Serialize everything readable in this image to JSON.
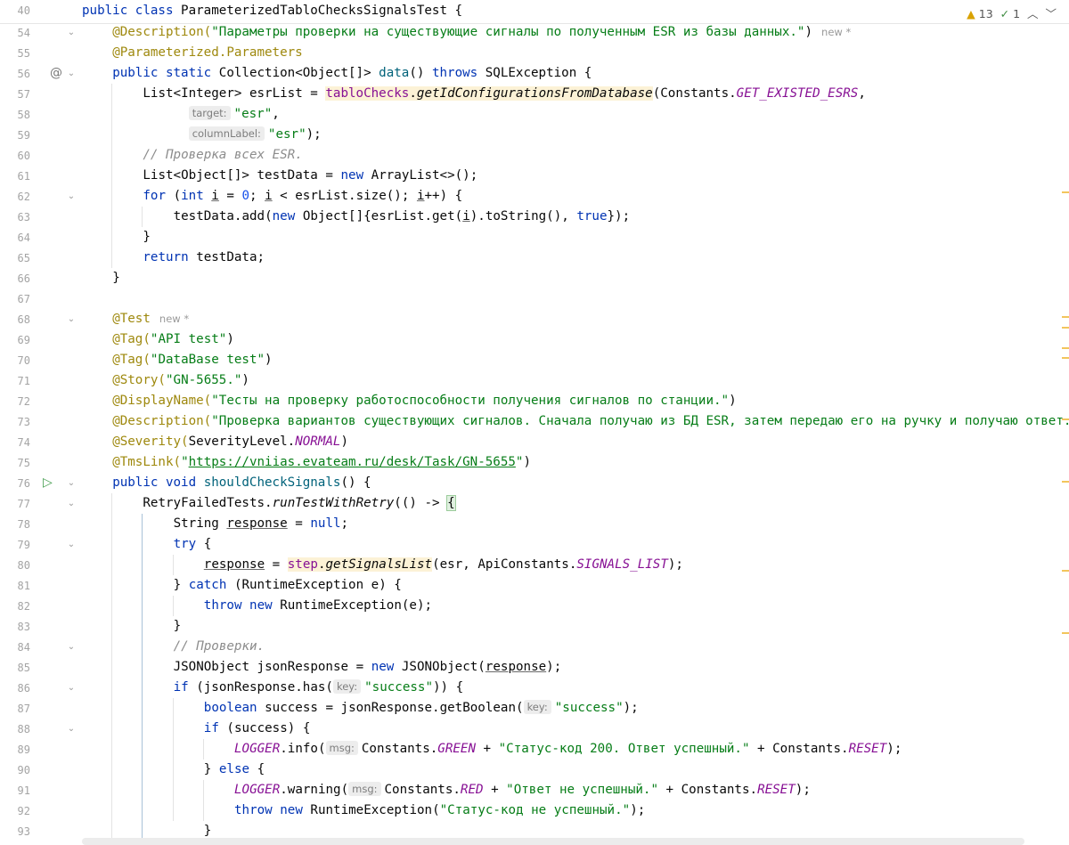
{
  "sticky": {
    "line_no": "40",
    "parts": [
      {
        "t": "public class ",
        "c": "kw"
      },
      {
        "t": "ParameterizedTabloChecksSignalsTest {",
        "c": ""
      }
    ]
  },
  "inspection": {
    "warnings": "13",
    "weak": "1"
  },
  "icons": {
    "warning": "warning-icon",
    "check": "check-icon",
    "up": "chevron-up-icon",
    "down": "chevron-down-icon",
    "run": "run-icon",
    "override": "implementation-icon",
    "fold": "fold-icon"
  },
  "lines": [
    {
      "n": "54",
      "fold": true,
      "parts": [
        {
          "t": "@Description(",
          "c": "an"
        },
        {
          "t": "\"Параметры проверки на существующие сигналы по полученным ESR из базы данных.\"",
          "c": "str"
        },
        {
          "t": ")",
          "c": ""
        },
        {
          "t": "new *",
          "c": "new"
        }
      ]
    },
    {
      "n": "55",
      "parts": [
        {
          "t": "@Parameterized.",
          "c": "an"
        },
        {
          "t": "Parameters",
          "c": "an"
        }
      ]
    },
    {
      "n": "56",
      "fold": true,
      "icon": "override",
      "parts": [
        {
          "t": "public static ",
          "c": "kw"
        },
        {
          "t": "Collection<Object[]> ",
          "c": ""
        },
        {
          "t": "data",
          "c": "fn"
        },
        {
          "t": "() ",
          "c": ""
        },
        {
          "t": "throws ",
          "c": "kw"
        },
        {
          "t": "SQLException {",
          "c": ""
        }
      ]
    },
    {
      "n": "57",
      "parts": [
        {
          "t": "List<Integer> esrList = ",
          "c": ""
        },
        {
          "t": "tabloChecks",
          "c": "fld hl"
        },
        {
          "t": ".",
          "c": "hl"
        },
        {
          "t": "getIdConfigurationsFromDatabase",
          "c": "it hl"
        },
        {
          "t": "(Constants.",
          "c": ""
        },
        {
          "t": "GET_EXISTED_ESRS",
          "c": "cst"
        },
        {
          "t": ",",
          "c": ""
        }
      ]
    },
    {
      "n": "58",
      "parts": [
        {
          "t": "target:",
          "c": "hint"
        },
        {
          "t": "\"esr\"",
          "c": "str"
        },
        {
          "t": ",",
          "c": ""
        }
      ]
    },
    {
      "n": "59",
      "parts": [
        {
          "t": "columnLabel:",
          "c": "hint"
        },
        {
          "t": "\"esr\"",
          "c": "str"
        },
        {
          "t": ");",
          "c": ""
        }
      ]
    },
    {
      "n": "60",
      "parts": [
        {
          "t": "// Проверка всех ESR.",
          "c": "cm"
        }
      ]
    },
    {
      "n": "61",
      "parts": [
        {
          "t": "List<Object[]> testData = ",
          "c": ""
        },
        {
          "t": "new ",
          "c": "kw"
        },
        {
          "t": "ArrayList<>();",
          "c": ""
        }
      ]
    },
    {
      "n": "62",
      "fold": true,
      "parts": [
        {
          "t": "for ",
          "c": "kw"
        },
        {
          "t": "(",
          "c": ""
        },
        {
          "t": "int ",
          "c": "kw"
        },
        {
          "t": "i",
          "c": "ul"
        },
        {
          "t": " = ",
          "c": ""
        },
        {
          "t": "0",
          "c": "num"
        },
        {
          "t": "; ",
          "c": ""
        },
        {
          "t": "i",
          "c": "ul"
        },
        {
          "t": " < esrList.size(); ",
          "c": ""
        },
        {
          "t": "i",
          "c": "ul"
        },
        {
          "t": "++) {",
          "c": ""
        }
      ]
    },
    {
      "n": "63",
      "parts": [
        {
          "t": "testData.add(",
          "c": ""
        },
        {
          "t": "new ",
          "c": "kw"
        },
        {
          "t": "Object[]{esrList.get(",
          "c": ""
        },
        {
          "t": "i",
          "c": "ul"
        },
        {
          "t": ").toString(), ",
          "c": ""
        },
        {
          "t": "true",
          "c": "kw"
        },
        {
          "t": "});",
          "c": ""
        }
      ]
    },
    {
      "n": "64",
      "parts": [
        {
          "t": "}",
          "c": ""
        }
      ]
    },
    {
      "n": "65",
      "parts": [
        {
          "t": "return ",
          "c": "kw"
        },
        {
          "t": "testData;",
          "c": ""
        }
      ]
    },
    {
      "n": "66",
      "parts": [
        {
          "t": "}",
          "c": ""
        }
      ]
    },
    {
      "n": "67",
      "parts": []
    },
    {
      "n": "68",
      "fold": true,
      "parts": [
        {
          "t": "@Test",
          "c": "an"
        },
        {
          "t": "new *",
          "c": "new"
        }
      ]
    },
    {
      "n": "69",
      "parts": [
        {
          "t": "@Tag(",
          "c": "an"
        },
        {
          "t": "\"API test\"",
          "c": "str"
        },
        {
          "t": ")",
          "c": ""
        }
      ]
    },
    {
      "n": "70",
      "parts": [
        {
          "t": "@Tag(",
          "c": "an"
        },
        {
          "t": "\"DataBase test\"",
          "c": "str"
        },
        {
          "t": ")",
          "c": ""
        }
      ]
    },
    {
      "n": "71",
      "parts": [
        {
          "t": "@Story(",
          "c": "an"
        },
        {
          "t": "\"GN-5655.\"",
          "c": "str"
        },
        {
          "t": ")",
          "c": ""
        }
      ]
    },
    {
      "n": "72",
      "parts": [
        {
          "t": "@DisplayName(",
          "c": "an"
        },
        {
          "t": "\"Тесты на проверку работоспособности получения сигналов по станции.\"",
          "c": "str"
        },
        {
          "t": ")",
          "c": ""
        }
      ]
    },
    {
      "n": "73",
      "parts": [
        {
          "t": "@Description(",
          "c": "an"
        },
        {
          "t": "\"Проверка вариантов существующих сигналов. Сначала получаю из БД ESR, затем передаю его на ручку и получаю ответ.\"",
          "c": "str"
        },
        {
          "t": ")",
          "c": ""
        }
      ]
    },
    {
      "n": "74",
      "parts": [
        {
          "t": "@Severity(",
          "c": "an"
        },
        {
          "t": "SeverityLevel.",
          "c": ""
        },
        {
          "t": "NORMAL",
          "c": "cst"
        },
        {
          "t": ")",
          "c": ""
        }
      ]
    },
    {
      "n": "75",
      "parts": [
        {
          "t": "@TmsLink(",
          "c": "an"
        },
        {
          "t": "\"",
          "c": "str"
        },
        {
          "t": "https://vniias.evateam.ru/desk/Task/GN-5655",
          "c": "link"
        },
        {
          "t": "\"",
          "c": "str"
        },
        {
          "t": ")",
          "c": ""
        }
      ]
    },
    {
      "n": "76",
      "fold": true,
      "icon": "run",
      "parts": [
        {
          "t": "public void ",
          "c": "kw"
        },
        {
          "t": "shouldCheckSignals",
          "c": "fn"
        },
        {
          "t": "() {",
          "c": ""
        }
      ]
    },
    {
      "n": "77",
      "fold": true,
      "parts": [
        {
          "t": "RetryFailedTests.",
          "c": ""
        },
        {
          "t": "runTestWithRetry",
          "c": "it"
        },
        {
          "t": "(() -> ",
          "c": ""
        },
        {
          "t": "{",
          "c": "brace"
        }
      ]
    },
    {
      "n": "78",
      "parts": [
        {
          "t": "String ",
          "c": ""
        },
        {
          "t": "response",
          "c": "ul"
        },
        {
          "t": " = ",
          "c": ""
        },
        {
          "t": "null",
          "c": "kw"
        },
        {
          "t": ";",
          "c": ""
        }
      ]
    },
    {
      "n": "79",
      "fold": true,
      "parts": [
        {
          "t": "try ",
          "c": "kw"
        },
        {
          "t": "{",
          "c": ""
        }
      ]
    },
    {
      "n": "80",
      "parts": [
        {
          "t": "response",
          "c": "ul"
        },
        {
          "t": " = ",
          "c": ""
        },
        {
          "t": "step",
          "c": "fld hl"
        },
        {
          "t": ".",
          "c": "hl"
        },
        {
          "t": "getSignalsList",
          "c": "it hl"
        },
        {
          "t": "(esr, ApiConstants.",
          "c": ""
        },
        {
          "t": "SIGNALS_LIST",
          "c": "cst"
        },
        {
          "t": ");",
          "c": ""
        }
      ]
    },
    {
      "n": "81",
      "parts": [
        {
          "t": "} ",
          "c": ""
        },
        {
          "t": "catch ",
          "c": "kw"
        },
        {
          "t": "(RuntimeException e) {",
          "c": ""
        }
      ]
    },
    {
      "n": "82",
      "parts": [
        {
          "t": "throw new ",
          "c": "kw"
        },
        {
          "t": "RuntimeException(e);",
          "c": ""
        }
      ]
    },
    {
      "n": "83",
      "parts": [
        {
          "t": "}",
          "c": ""
        }
      ]
    },
    {
      "n": "84",
      "fold": true,
      "parts": [
        {
          "t": "// Проверки.",
          "c": "cm"
        }
      ]
    },
    {
      "n": "85",
      "parts": [
        {
          "t": "JSONObject jsonResponse = ",
          "c": ""
        },
        {
          "t": "new ",
          "c": "kw"
        },
        {
          "t": "JSONObject(",
          "c": ""
        },
        {
          "t": "response",
          "c": "ul"
        },
        {
          "t": ");",
          "c": ""
        }
      ]
    },
    {
      "n": "86",
      "fold": true,
      "parts": [
        {
          "t": "if ",
          "c": "kw"
        },
        {
          "t": "(jsonResponse.has(",
          "c": ""
        },
        {
          "t": "key:",
          "c": "hint"
        },
        {
          "t": "\"success\"",
          "c": "str"
        },
        {
          "t": ")) {",
          "c": ""
        }
      ]
    },
    {
      "n": "87",
      "parts": [
        {
          "t": "boolean ",
          "c": "kw"
        },
        {
          "t": "success = jsonResponse.getBoolean(",
          "c": ""
        },
        {
          "t": "key:",
          "c": "hint"
        },
        {
          "t": "\"success\"",
          "c": "str"
        },
        {
          "t": ");",
          "c": ""
        }
      ]
    },
    {
      "n": "88",
      "fold": true,
      "parts": [
        {
          "t": "if ",
          "c": "kw"
        },
        {
          "t": "(success) {",
          "c": ""
        }
      ]
    },
    {
      "n": "89",
      "parts": [
        {
          "t": "LOGGER",
          "c": "cst"
        },
        {
          "t": ".info(",
          "c": ""
        },
        {
          "t": "msg:",
          "c": "hint"
        },
        {
          "t": "Constants.",
          "c": ""
        },
        {
          "t": "GREEN",
          "c": "cst"
        },
        {
          "t": " + ",
          "c": ""
        },
        {
          "t": "\"Статус-код 200. Ответ успешный.\"",
          "c": "str"
        },
        {
          "t": " + Constants.",
          "c": ""
        },
        {
          "t": "RESET",
          "c": "cst"
        },
        {
          "t": ");",
          "c": ""
        }
      ]
    },
    {
      "n": "90",
      "parts": [
        {
          "t": "} ",
          "c": ""
        },
        {
          "t": "else ",
          "c": "kw"
        },
        {
          "t": "{",
          "c": ""
        }
      ]
    },
    {
      "n": "91",
      "parts": [
        {
          "t": "LOGGER",
          "c": "cst"
        },
        {
          "t": ".warning(",
          "c": ""
        },
        {
          "t": "msg:",
          "c": "hint"
        },
        {
          "t": "Constants.",
          "c": ""
        },
        {
          "t": "RED",
          "c": "cst"
        },
        {
          "t": " + ",
          "c": ""
        },
        {
          "t": "\"Ответ не успешный.\"",
          "c": "str"
        },
        {
          "t": " + Constants.",
          "c": ""
        },
        {
          "t": "RESET",
          "c": "cst"
        },
        {
          "t": ");",
          "c": ""
        }
      ]
    },
    {
      "n": "92",
      "parts": [
        {
          "t": "throw new ",
          "c": "kw"
        },
        {
          "t": "RuntimeException(",
          "c": ""
        },
        {
          "t": "\"Статус-код не успешный.\"",
          "c": "str"
        },
        {
          "t": ");",
          "c": ""
        }
      ]
    },
    {
      "n": "93",
      "parts": [
        {
          "t": "}",
          "c": ""
        }
      ]
    }
  ],
  "colors": {
    "keyword": "#0033b3",
    "annotation": "#9e880d",
    "string": "#067d17",
    "comment": "#8c8c8c",
    "constant": "#871094"
  }
}
